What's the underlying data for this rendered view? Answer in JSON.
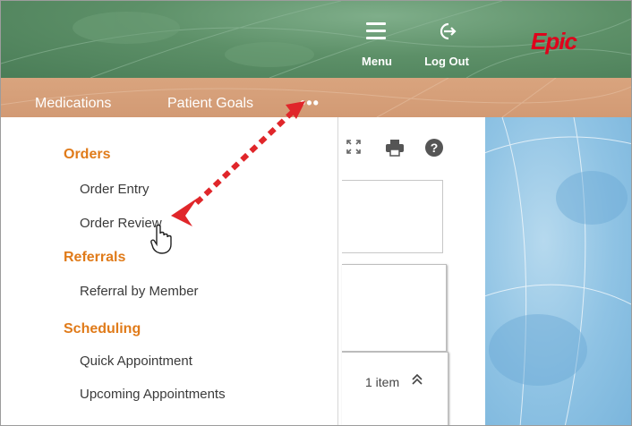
{
  "header": {
    "menu_label": "Menu",
    "logout_label": "Log Out",
    "logo_text": "Epic"
  },
  "nav": {
    "items": [
      {
        "label": "Medications"
      },
      {
        "label": "Patient Goals"
      }
    ],
    "more_label": "•••"
  },
  "dropdown": {
    "sections": [
      {
        "title": "Orders",
        "items": [
          "Order Entry",
          "Order Review"
        ]
      },
      {
        "title": "Referrals",
        "items": [
          "Referral by Member"
        ]
      },
      {
        "title": "Scheduling",
        "items": [
          "Quick Appointment",
          "Upcoming Appointments"
        ]
      }
    ]
  },
  "content": {
    "item_count": "1 item",
    "collapse_glyph": "≈"
  },
  "colors": {
    "header_green": "#5d9068",
    "nav_orange": "#d29a74",
    "section_orange": "#e07b1a",
    "arrow_red": "#e0262a",
    "epic_red": "#e0001b"
  },
  "icons": [
    "menu-icon",
    "logout-icon",
    "expand-icon",
    "print-icon",
    "help-icon",
    "hand-cursor-icon",
    "double-chevron-up-icon"
  ]
}
